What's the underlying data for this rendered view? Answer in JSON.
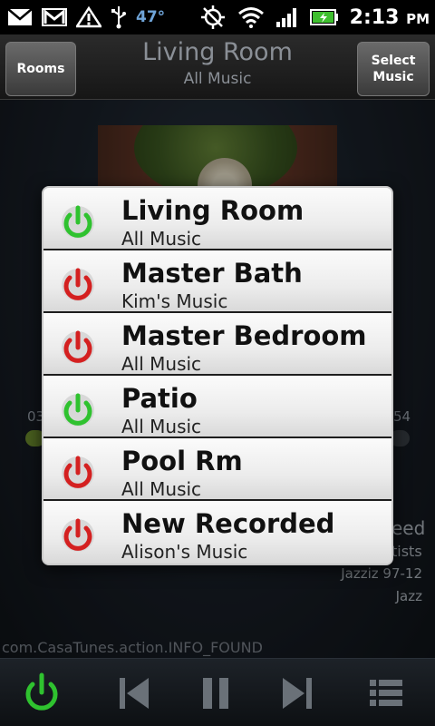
{
  "status_bar": {
    "temperature": "47°",
    "time": "2:13",
    "ampm": "PM",
    "icons": [
      "gmail-icon",
      "warning-icon",
      "usb-icon",
      "gps-off-icon",
      "wifi-icon",
      "signal-icon",
      "battery-icon"
    ]
  },
  "header": {
    "rooms_label": "Rooms",
    "title": "Living Room",
    "subtitle": "All Music",
    "select_music_label_1": "Select",
    "select_music_label_2": "Music"
  },
  "player": {
    "time_elapsed": "03",
    "time_total": "54",
    "artist": "eed",
    "artists_line": "tists",
    "album": "Jazziz 97-12",
    "genre": "Jazz"
  },
  "intent_text": "com.CasaTunes.action.INFO_FOUND",
  "rooms_dialog": {
    "rooms": [
      {
        "name": "Living Room",
        "source": "All Music",
        "power": "on"
      },
      {
        "name": "Master Bath",
        "source": "Kim's Music",
        "power": "off"
      },
      {
        "name": "Master Bedroom",
        "source": "All Music",
        "power": "off"
      },
      {
        "name": "Patio",
        "source": "All Music",
        "power": "on"
      },
      {
        "name": "Pool Rm",
        "source": "All Music",
        "power": "off"
      },
      {
        "name": "New Recorded",
        "source": "Alison's Music",
        "power": "off"
      }
    ]
  },
  "colors": {
    "power_on": "#2fc22f",
    "power_off": "#d42020",
    "header_text": "#8a8f96"
  },
  "controls": [
    "power-icon",
    "previous-icon",
    "pause-icon",
    "next-icon",
    "list-icon"
  ]
}
